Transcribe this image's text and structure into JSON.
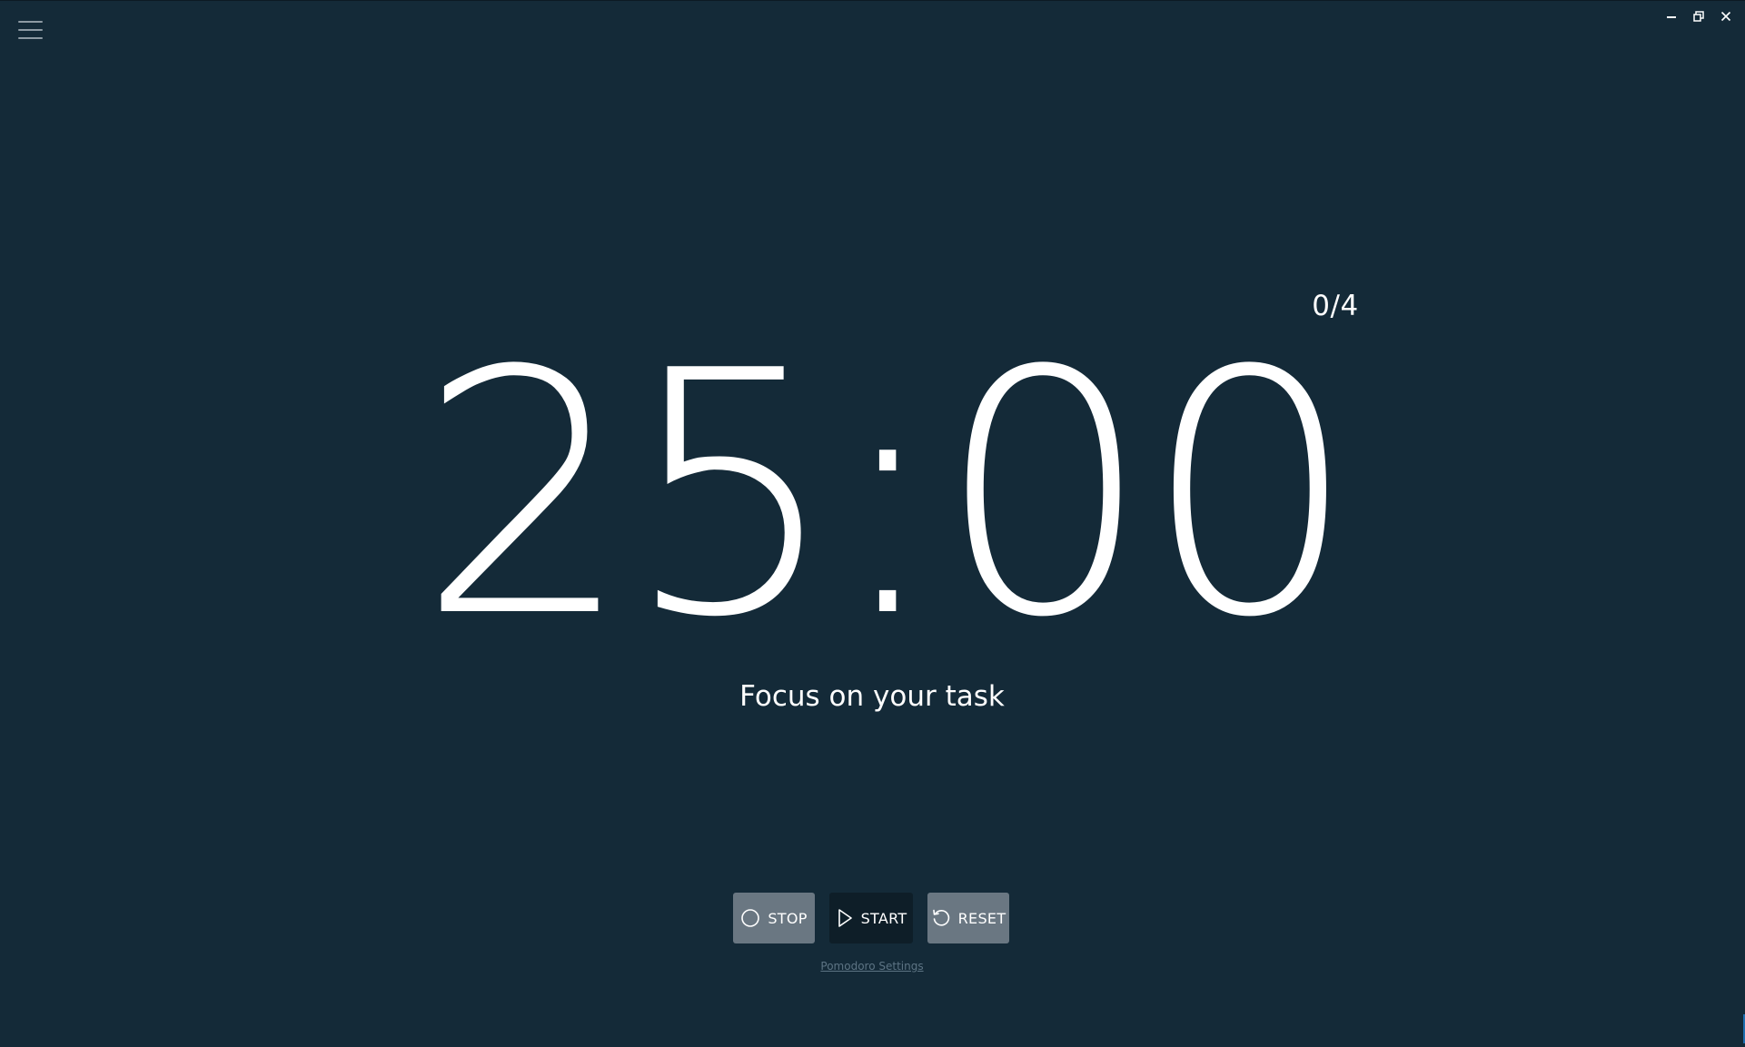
{
  "header": {
    "menu_icon": "hamburger-menu-icon",
    "window_controls": {
      "minimize_icon": "minimize-icon",
      "restore_icon": "restore-icon",
      "close_icon": "close-icon"
    }
  },
  "timer": {
    "time": "25:00",
    "session_count": "0/4",
    "status": "Focus on your task"
  },
  "controls": {
    "stop_label": "STOP",
    "stop_icon": "circle-icon",
    "start_label": "START",
    "start_icon": "play-icon",
    "reset_label": "RESET",
    "reset_icon": "reset-icon"
  },
  "footer": {
    "settings_link": "Pomodoro Settings"
  },
  "colors": {
    "background": "#142a38",
    "text": "#ffffff",
    "secondary_button": "#6a7782",
    "primary_button": "#0e1e28",
    "link": "#5d7484"
  }
}
